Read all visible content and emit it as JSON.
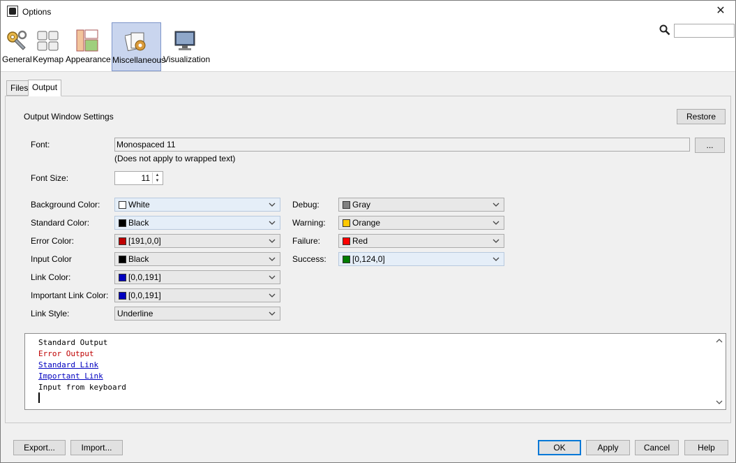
{
  "window": {
    "title": "Options"
  },
  "categories": [
    {
      "label": "General"
    },
    {
      "label": "Keymap"
    },
    {
      "label": "Appearance"
    },
    {
      "label": "Miscellaneous",
      "selected": true
    },
    {
      "label": "Visualization"
    }
  ],
  "search": {
    "value": ""
  },
  "tabs": [
    {
      "label": "Files"
    },
    {
      "label": "Output",
      "active": true
    }
  ],
  "section": {
    "title": "Output Window Settings",
    "restore_label": "Restore"
  },
  "font": {
    "label": "Font:",
    "value": "Monospaced 11",
    "browse_label": "...",
    "note": "(Does not apply to wrapped text)"
  },
  "font_size": {
    "label": "Font Size:",
    "value": "11"
  },
  "left_colors": [
    {
      "label": "Background Color:",
      "value": "White",
      "swatch": "#ffffff",
      "highlight": true
    },
    {
      "label": "Standard Color:",
      "value": "Black",
      "swatch": "#000000",
      "highlight": true
    },
    {
      "label": "Error Color:",
      "value": "[191,0,0]",
      "swatch": "#bf0000"
    },
    {
      "label": "Input Color",
      "value": "Black",
      "swatch": "#000000"
    },
    {
      "label": "Link Color:",
      "value": "[0,0,191]",
      "swatch": "#0000bf"
    },
    {
      "label": "Important Link Color:",
      "value": "[0,0,191]",
      "swatch": "#0000bf"
    }
  ],
  "link_style": {
    "label": "Link Style:",
    "value": "Underline"
  },
  "right_colors": [
    {
      "label": "Debug:",
      "value": "Gray",
      "swatch": "#808080"
    },
    {
      "label": "Warning:",
      "value": "Orange",
      "swatch": "#ffc800"
    },
    {
      "label": "Failure:",
      "value": "Red",
      "swatch": "#ff0000"
    },
    {
      "label": "Success:",
      "value": "[0,124,0]",
      "swatch": "#007c00",
      "highlight": true
    }
  ],
  "preview": {
    "lines": [
      {
        "text": "Standard Output",
        "color": "#000000",
        "underline": false
      },
      {
        "text": "Error Output",
        "color": "#bf0000",
        "underline": false
      },
      {
        "text": "Standard Link",
        "color": "#0000bf",
        "underline": true
      },
      {
        "text": "Important Link",
        "color": "#0000bf",
        "underline": true
      },
      {
        "text": "Input from keyboard",
        "color": "#000000",
        "underline": false
      }
    ]
  },
  "footer": {
    "export_label": "Export...",
    "import_label": "Import...",
    "ok_label": "OK",
    "apply_label": "Apply",
    "cancel_label": "Cancel",
    "help_label": "Help"
  }
}
